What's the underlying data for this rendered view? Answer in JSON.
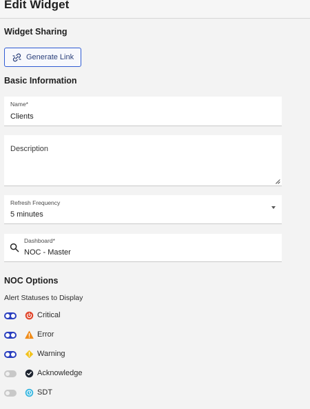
{
  "header": {
    "title": "Edit Widget"
  },
  "sharing": {
    "section_title": "Widget Sharing",
    "generate_link_label": "Generate Link"
  },
  "basic": {
    "section_title": "Basic Information",
    "name": {
      "label": "Name*",
      "value": "Clients"
    },
    "description": {
      "label": "Description",
      "value": ""
    },
    "refresh": {
      "label": "Refresh Frequency",
      "value": "5 minutes"
    },
    "dashboard": {
      "label": "Dashboard*",
      "value": "NOC - Master"
    }
  },
  "noc": {
    "section_title": "NOC Options",
    "alert_statuses_label": "Alert Statuses to Display",
    "statuses": [
      {
        "label": "Critical",
        "enabled": true,
        "icon": "critical-icon",
        "color": "#e0452b"
      },
      {
        "label": "Error",
        "enabled": true,
        "icon": "error-icon",
        "color": "#f08c1a"
      },
      {
        "label": "Warning",
        "enabled": true,
        "icon": "warning-icon",
        "color": "#f2c21b"
      },
      {
        "label": "Acknowledge",
        "enabled": false,
        "icon": "acknowledge-icon",
        "color": "#1e2430"
      },
      {
        "label": "SDT",
        "enabled": false,
        "icon": "sdt-icon",
        "color": "#38b6e0"
      }
    ]
  },
  "colors": {
    "accent": "#2a3fbf",
    "toggle_off": "#c8c8c8"
  }
}
